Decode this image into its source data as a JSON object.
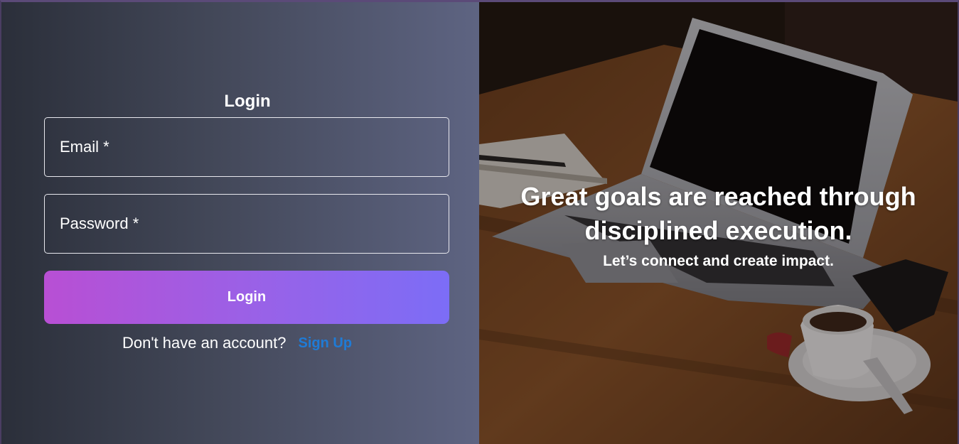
{
  "form": {
    "title": "Login",
    "email_label": "Email *",
    "password_label": "Password *",
    "login_button": "Login",
    "signup_prompt": "Don't have an account?",
    "signup_link": "Sign Up"
  },
  "hero": {
    "headline_line1": "Great goals are reached through",
    "headline_line2": "disciplined execution.",
    "subtext": "Let’s connect and create impact."
  },
  "colors": {
    "button_gradient_start": "#b84fd4",
    "button_gradient_end": "#7c6df6",
    "link": "#1f7bd6"
  },
  "icons": {
    "hero_image": "laptop-desk-photo"
  }
}
